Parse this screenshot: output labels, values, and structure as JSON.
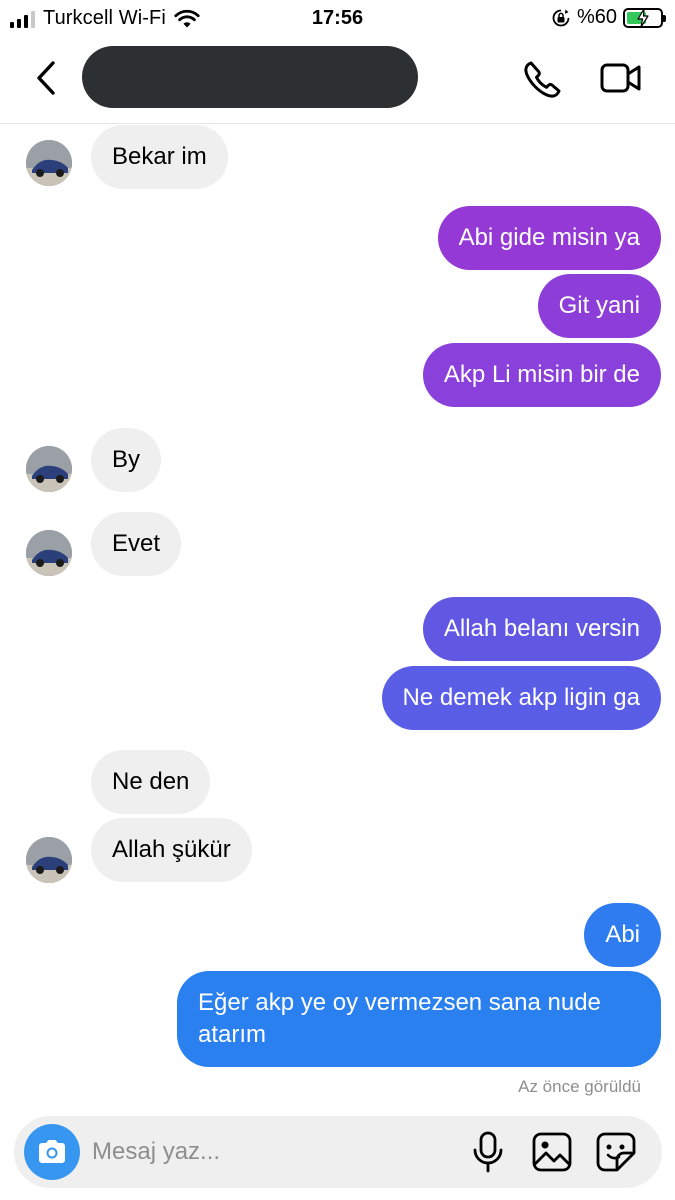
{
  "status_bar": {
    "carrier": "Turkcell Wi-Fi",
    "time": "17:56",
    "battery": "%60",
    "battery_level": 0.6,
    "signal_icon": "signal-bars-icon",
    "wifi_icon": "wifi-icon",
    "rotation_lock_icon": "rotation-lock-icon",
    "battery_icon": "battery-charging-icon"
  },
  "header": {
    "contact_name": "",
    "back_icon": "chevron-left-icon",
    "call_icon": "phone-icon",
    "video_icon": "video-camera-icon"
  },
  "colors": {
    "purple": "#9438d6",
    "indigo": "#5a5ee6",
    "blue": "#2b80f0",
    "incoming_bubble": "#efefef",
    "composer_bg": "#efefef",
    "camera_button": "#3797f0"
  },
  "messages": [
    {
      "sender": "them",
      "text": "Bekar im"
    },
    {
      "sender": "me",
      "text": "Abi gide misin ya"
    },
    {
      "sender": "me",
      "text": "Git yani"
    },
    {
      "sender": "me",
      "text": "Akp Li misin bir de"
    },
    {
      "sender": "them",
      "text": "By"
    },
    {
      "sender": "them",
      "text": "Evet"
    },
    {
      "sender": "me",
      "text": "Allah belanı versin"
    },
    {
      "sender": "me",
      "text": "Ne demek akp ligin ga"
    },
    {
      "sender": "them",
      "text": "Ne den"
    },
    {
      "sender": "them",
      "text": "Allah şükür"
    },
    {
      "sender": "me",
      "text": "Abi"
    },
    {
      "sender": "me",
      "text": "Eğer akp ye oy vermezsen sana nude atarım"
    }
  ],
  "seen_status": "Az önce görüldü",
  "composer": {
    "placeholder": "Mesaj yaz...",
    "value": "",
    "camera_icon": "camera-icon",
    "mic_icon": "microphone-icon",
    "gallery_icon": "image-icon",
    "sticker_icon": "sticker-icon"
  }
}
